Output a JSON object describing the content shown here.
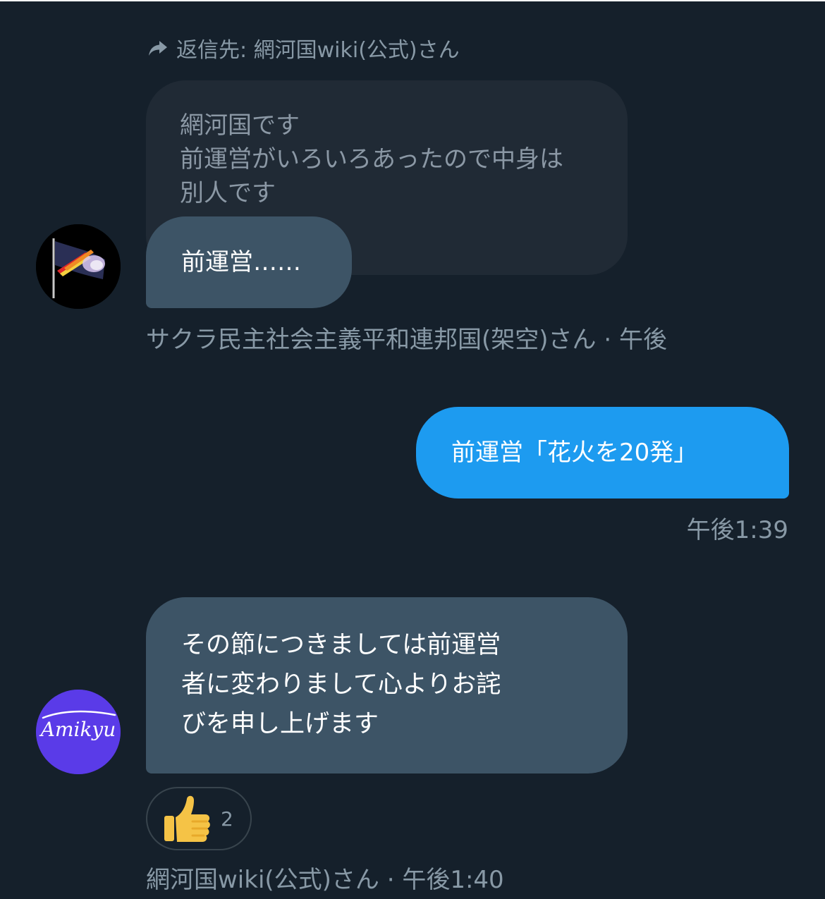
{
  "reply_context": {
    "icon": "reply-arrow-icon",
    "text": "返信先: 網河国wiki(公式)さん"
  },
  "quoted_message": {
    "lines": [
      "網河国です",
      "前運営がいろいろあったので中身は",
      "別人です"
    ]
  },
  "message_sakura": {
    "text": "前運営……",
    "avatar": "flag-avatar",
    "meta": "サクラ民主社会主義平和連邦国(架空)さん · 午後"
  },
  "message_mine": {
    "text": "前運営「花火を20発」",
    "meta": "午後1:39"
  },
  "message_amikyu": {
    "lines": [
      "その節につきましては前運営",
      "者に変わりまして心よりお詫",
      "びを申し上げます"
    ],
    "avatar_text": "Amikyu",
    "meta": "網河国wiki(公式)さん · 午後1:40"
  },
  "reaction": {
    "emoji": "thumbs-up-icon",
    "count": "2"
  },
  "colors": {
    "background": "#15202b",
    "their_bubble": "#3d5466",
    "my_bubble": "#1d9bf0",
    "quoted_bubble": "#202a35",
    "meta_text": "#8899a6"
  }
}
